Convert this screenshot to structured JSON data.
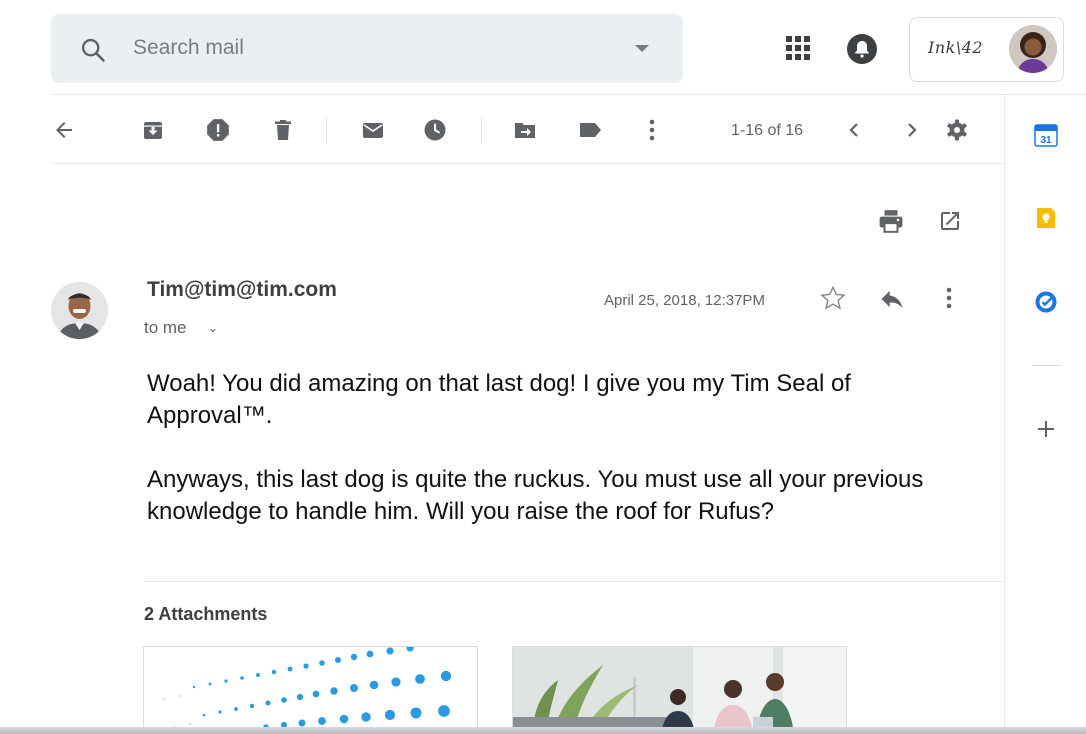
{
  "search": {
    "placeholder": "Search mail"
  },
  "account": {
    "brand": "Ink\\42"
  },
  "toolbar": {
    "page_count": "1-16 of 16",
    "icons": [
      "back-arrow-icon",
      "archive-icon",
      "report-spam-icon",
      "delete-icon",
      "mark-unread-icon",
      "snooze-icon",
      "move-to-icon",
      "label-icon",
      "more-vertical-icon",
      "chevron-left-icon",
      "chevron-right-icon",
      "settings-gear-icon"
    ]
  },
  "side_panel": {
    "calendar_day": "31",
    "apps": [
      "calendar-icon",
      "keep-icon",
      "tasks-icon",
      "add-icon"
    ]
  },
  "message": {
    "sender": "Tim@tim@tim.com",
    "recipient": "to me",
    "timestamp": "April 25, 2018, 12:37PM",
    "body": [
      "Woah! You did amazing on that last dog! I give you my Tim Seal of Approval™.",
      "Anyways, this last dog is quite the ruckus. You must use all your previous knowledge to handle him. Will you raise the roof for Rufus?"
    ]
  },
  "attachments": {
    "title": "2 Attachments",
    "items": [
      "attachment-dots-image",
      "attachment-office-photo"
    ]
  },
  "colors": {
    "accent_blue": "#1a73e8",
    "keep_yellow": "#f9bb00",
    "icon_gray": "#5f6368",
    "search_bg": "#eceff1"
  }
}
